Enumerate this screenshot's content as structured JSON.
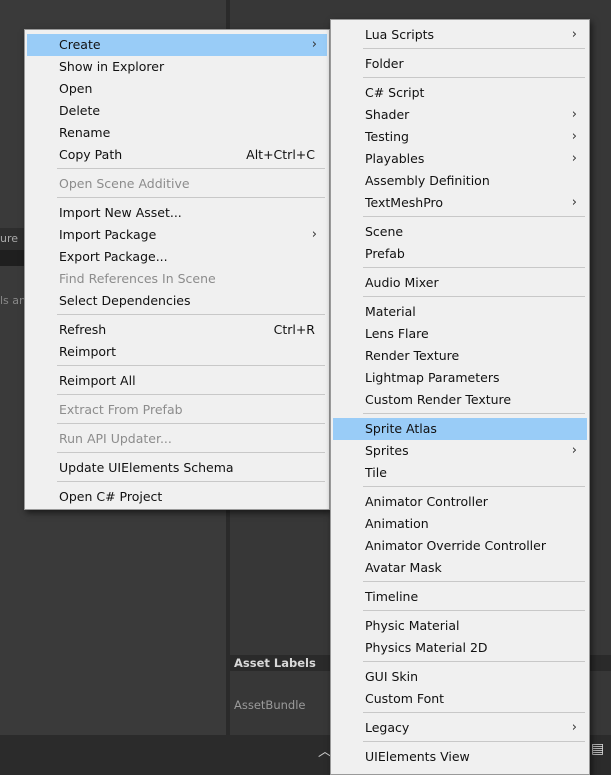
{
  "background": {
    "left_strip_text1": "ure",
    "left_strip_text2": "ls an",
    "asset_labels_title": "Asset Labels",
    "assetbundle_label": "AssetBundle"
  },
  "main_menu": {
    "items": [
      {
        "label": "Create",
        "submenu": true,
        "highlighted": true
      },
      {
        "label": "Show in Explorer"
      },
      {
        "label": "Open"
      },
      {
        "label": "Delete"
      },
      {
        "label": "Rename"
      },
      {
        "label": "Copy Path",
        "shortcut": "Alt+Ctrl+C"
      },
      {
        "label": "Open Scene Additive",
        "disabled": true
      },
      {
        "label": "Import New Asset..."
      },
      {
        "label": "Import Package",
        "submenu": true
      },
      {
        "label": "Export Package..."
      },
      {
        "label": "Find References In Scene",
        "disabled": true
      },
      {
        "label": "Select Dependencies"
      },
      {
        "label": "Refresh",
        "shortcut": "Ctrl+R"
      },
      {
        "label": "Reimport"
      },
      {
        "label": "Reimport All"
      },
      {
        "label": "Extract From Prefab",
        "disabled": true
      },
      {
        "label": "Run API Updater...",
        "disabled": true
      },
      {
        "label": "Update UIElements Schema"
      },
      {
        "label": "Open C# Project"
      }
    ]
  },
  "create_menu": {
    "items": [
      {
        "label": "Lua Scripts",
        "submenu": true
      },
      {
        "label": "Folder"
      },
      {
        "label": "C# Script"
      },
      {
        "label": "Shader",
        "submenu": true
      },
      {
        "label": "Testing",
        "submenu": true
      },
      {
        "label": "Playables",
        "submenu": true
      },
      {
        "label": "Assembly Definition"
      },
      {
        "label": "TextMeshPro",
        "submenu": true
      },
      {
        "label": "Scene"
      },
      {
        "label": "Prefab"
      },
      {
        "label": "Audio Mixer"
      },
      {
        "label": "Material"
      },
      {
        "label": "Lens Flare"
      },
      {
        "label": "Render Texture"
      },
      {
        "label": "Lightmap Parameters"
      },
      {
        "label": "Custom Render Texture"
      },
      {
        "label": "Sprite Atlas",
        "highlighted": true
      },
      {
        "label": "Sprites",
        "submenu": true
      },
      {
        "label": "Tile"
      },
      {
        "label": "Animator Controller"
      },
      {
        "label": "Animation"
      },
      {
        "label": "Animator Override Controller"
      },
      {
        "label": "Avatar Mask"
      },
      {
        "label": "Timeline"
      },
      {
        "label": "Physic Material"
      },
      {
        "label": "Physics Material 2D"
      },
      {
        "label": "GUI Skin"
      },
      {
        "label": "Custom Font"
      },
      {
        "label": "Legacy",
        "submenu": true
      },
      {
        "label": "UIElements View"
      }
    ]
  },
  "colors": {
    "menu_background": "#f0f0f0",
    "highlight": "#99ccf7",
    "disabled_text": "#8c8c8c",
    "editor_background": "#383838"
  },
  "icons": {
    "submenu_arrow": "chevron-right-icon",
    "status_up": "chevron-up-icon",
    "console": "console-icon"
  }
}
